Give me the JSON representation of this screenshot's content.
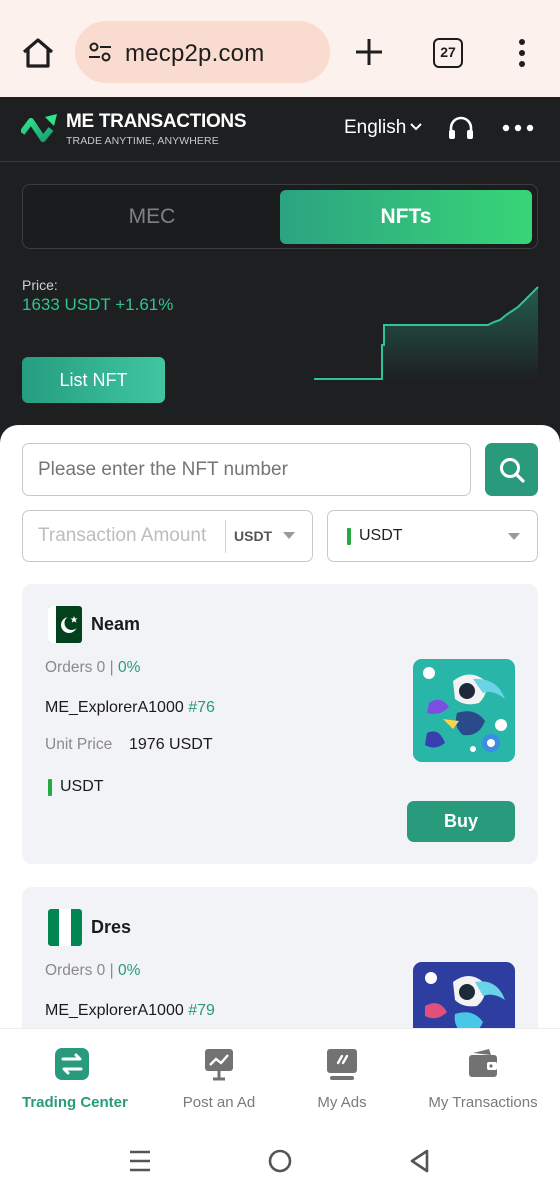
{
  "browser": {
    "url": "mecp2p.com",
    "tab_count": "27"
  },
  "header": {
    "brand_title": "ME TRANSACTIONS",
    "brand_tagline": "TRADE ANYTIME, ANYWHERE",
    "language": "English"
  },
  "toggle": {
    "option_mec": "MEC",
    "option_nfts": "NFTs",
    "selected": "NFTs"
  },
  "price": {
    "label": "Price:",
    "value": "1633 USDT +1.61%"
  },
  "list_nft_label": "List NFT",
  "filters": {
    "search_placeholder": "Please enter the NFT number",
    "amount_placeholder": "Transaction Amount",
    "amount_currency": "USDT",
    "payment_currency": "USDT"
  },
  "listings": [
    {
      "seller": "Neam",
      "orders_text": "Orders 0 |",
      "completion": "0%",
      "nft_name": "ME_ExplorerA1000",
      "nft_number": "#76",
      "unit_price_label": "Unit Price",
      "unit_price": "1976 USDT",
      "payment": "USDT",
      "buy_label": "Buy"
    },
    {
      "seller": "Dres",
      "orders_text": "Orders 0 |",
      "completion": "0%",
      "nft_name": "ME_ExplorerA1000",
      "nft_number": "#79"
    }
  ],
  "bottom_nav": [
    {
      "label": "Trading Center",
      "icon": "swap-icon",
      "active": true
    },
    {
      "label": "Post an Ad",
      "icon": "chart-board-icon",
      "active": false
    },
    {
      "label": "My Ads",
      "icon": "monitor-icon",
      "active": false
    },
    {
      "label": "My Transactions",
      "icon": "wallet-icon",
      "active": false
    }
  ],
  "colors": {
    "accent": "#2a9a7c",
    "header_bg": "#1e1f21",
    "price_green": "#2ec48d",
    "browser_bg": "#fdf1ed"
  }
}
